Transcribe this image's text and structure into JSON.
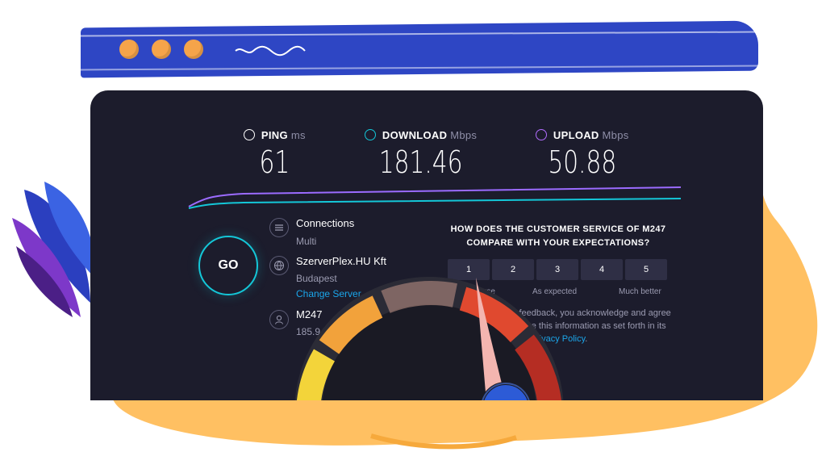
{
  "metrics": {
    "ping": {
      "label": "PING",
      "unit": "ms",
      "value": "61"
    },
    "download": {
      "label": "DOWNLOAD",
      "unit": "Mbps",
      "value": "181.46"
    },
    "upload": {
      "label": "UPLOAD",
      "unit": "Mbps",
      "value": "50.88"
    }
  },
  "go_label": "GO",
  "connections": {
    "title": "Connections",
    "mode": "Multi"
  },
  "server": {
    "name": "SzerverPlex.HU Kft",
    "city": "Budapest",
    "change_link": "Change Server"
  },
  "provider": {
    "name": "M247",
    "ip": "185.94.190.188"
  },
  "survey": {
    "question": "HOW DOES THE CUSTOMER SERVICE OF M247 COMPARE WITH YOUR EXPECTATIONS?",
    "ratings": [
      "1",
      "2",
      "3",
      "4",
      "5"
    ],
    "scale_low": "Much worse",
    "scale_mid": "As expected",
    "scale_high": "Much better",
    "disclaimer": "By submitting this feedback, you acknowledge and agree that Ookla may share this information as set forth in its",
    "privacy_link": "Privacy Policy",
    "disclaimer_end": "."
  },
  "colors": {
    "panel": "#1c1c2c",
    "accent_cyan": "#14c7d8",
    "download_icon": "#14c7d8",
    "upload_icon": "#b26dff",
    "link": "#1ba6ea",
    "browser_bar": "#2e46c4",
    "dots": "#f5a44a"
  },
  "icons": {
    "ping": "ping-icon",
    "download": "download-arrow-icon",
    "upload": "upload-arrow-icon",
    "connections": "connections-icon",
    "server": "globe-icon",
    "provider": "user-icon"
  }
}
